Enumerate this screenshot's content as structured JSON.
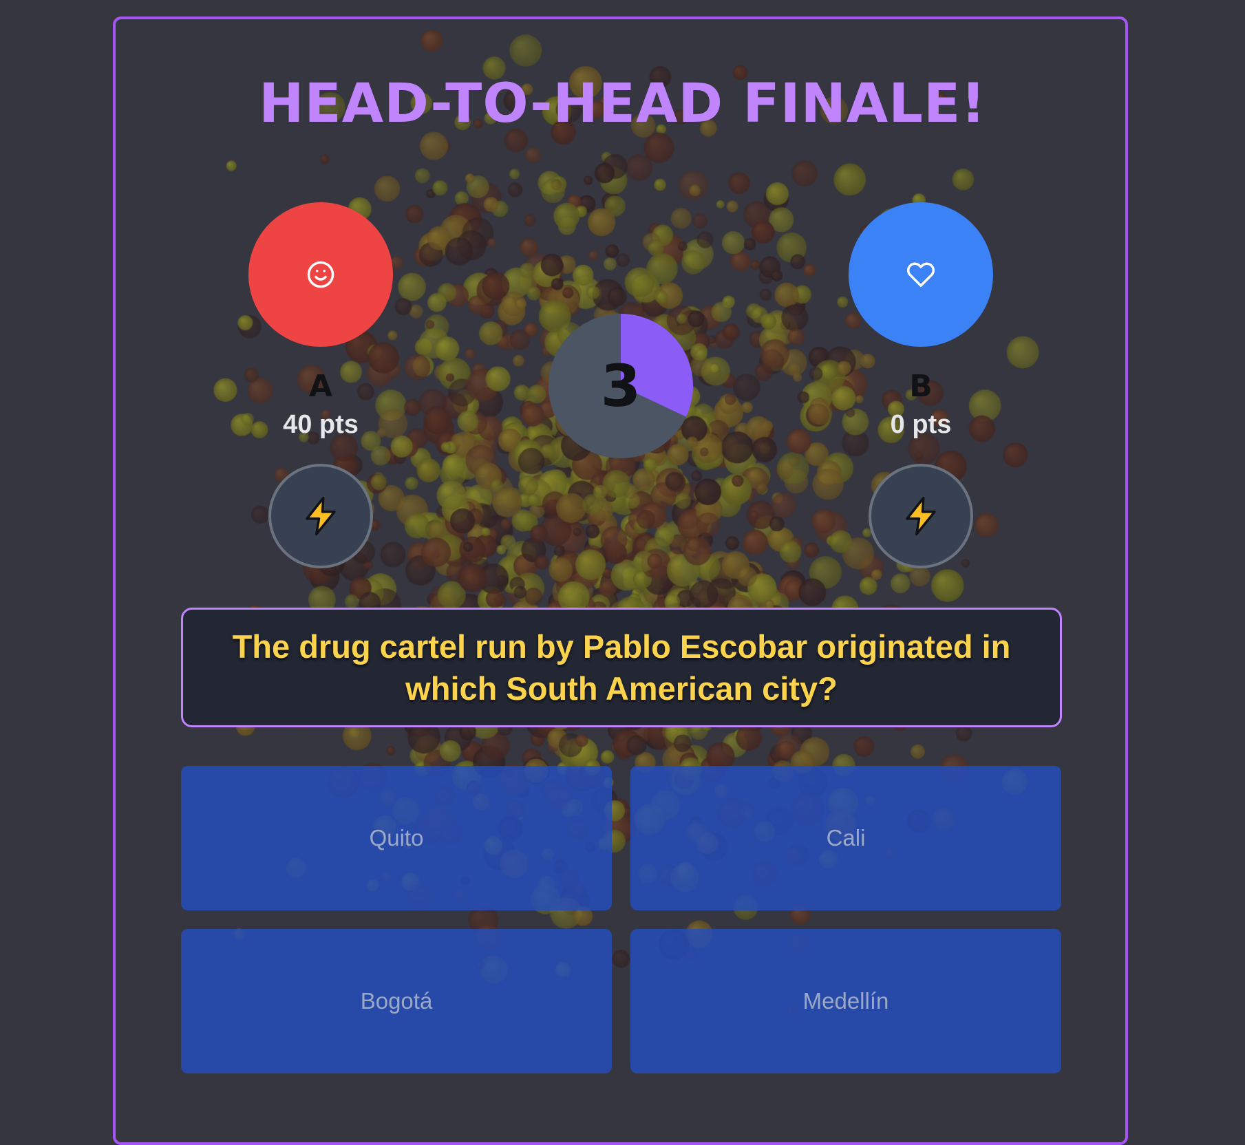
{
  "title": "HEAD-TO-HEAD FINALE!",
  "colors": {
    "accent": "#a855f7",
    "title": "#c084fc",
    "player_a": "#ef4444",
    "player_b": "#3b82f6",
    "question_text": "#fcd34d",
    "timer_fill": "#8b5cf6",
    "timer_track": "#4b5563"
  },
  "players": [
    {
      "name": "A",
      "score": "40 pts",
      "icon": "smiley-face-icon"
    },
    {
      "name": "B",
      "score": "0 pts",
      "icon": "heart-icon"
    }
  ],
  "powerup_icon": "lightning-bolt-icon",
  "timer": {
    "value": "3",
    "remaining_fraction": 0.32
  },
  "question": "The drug cartel run by Pablo Escobar originated in which South American city?",
  "answers": [
    "Quito",
    "Cali",
    "Bogotá",
    "Medellín"
  ]
}
